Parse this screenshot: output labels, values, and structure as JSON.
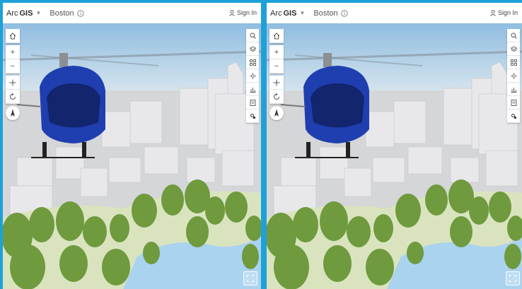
{
  "header": {
    "brand_prefix": "Arc",
    "brand_bold": "GIS",
    "scene_title": "Boston",
    "sign_in_label": "Sign In"
  },
  "left_toolbar_icons": [
    "home-icon",
    "zoom-in-icon",
    "zoom-out-icon",
    "pan-icon",
    "rotate-icon",
    "compass-icon"
  ],
  "right_toolbar_icons": [
    "search-icon",
    "layers-icon",
    "basemap-icon",
    "daylight-icon",
    "elevation-icon",
    "legend-icon",
    "settings-icon"
  ],
  "colors": {
    "frame": "#1ea1d8",
    "sky": "#9ec8e6",
    "water": "#a9d3ee",
    "trees": "#6f9a3e",
    "helicopter": "#1f3fb0"
  }
}
